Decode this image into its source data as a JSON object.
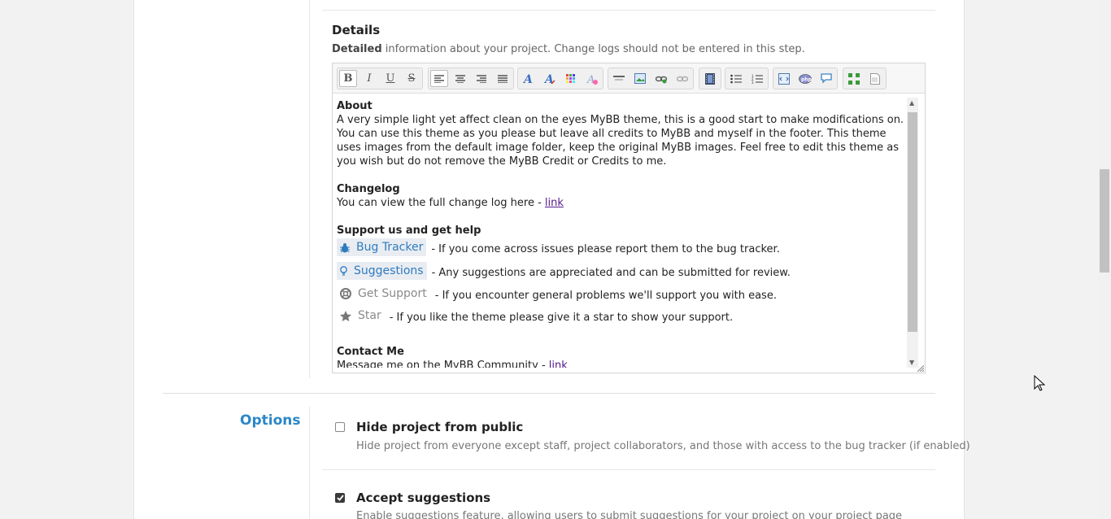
{
  "details": {
    "title": "Details",
    "desc_bold": "Detailed",
    "desc_rest": " information about your project. Change logs should not be entered in this step."
  },
  "toolbar": {
    "bold": "B",
    "italic": "I",
    "underline": "U",
    "strike": "S"
  },
  "content": {
    "about_heading": "About",
    "about_text": "A very simple light yet affect clean on the eyes MyBB theme, this is a good start to make modifications on. You can use this theme as you please but leave all credits to MyBB and myself in the footer. This theme uses images from the default image folder, keep the original MyBB images. Feel free to edit this theme as you wish but do not remove the MyBB Credit or Credits to me.",
    "changelog_heading": "Changelog",
    "changelog_text": "You can view the full change log here - ",
    "changelog_link": "link",
    "support_heading": "Support us and get help",
    "support": [
      {
        "label": "Bug Tracker",
        "text": "- If you come across issues please report them to the bug tracker."
      },
      {
        "label": "Suggestions",
        "text": "- Any suggestions are appreciated and can be submitted for review."
      },
      {
        "label": "Get Support",
        "text": "- If you encounter general problems we'll support you with ease."
      },
      {
        "label": "Star",
        "text": "- If you like the theme please give it a star to show your support."
      }
    ],
    "contact_heading": "Contact Me",
    "contact_text": "Message me on the MyBB Community - ",
    "contact_link": "link"
  },
  "options": {
    "label": "Options",
    "items": [
      {
        "title": "Hide project from public",
        "desc": "Hide project from everyone except staff, project collaborators, and those with access to the bug tracker (if enabled)",
        "checked": false
      },
      {
        "title": "Accept suggestions",
        "desc": "Enable suggestions feature, allowing users to submit suggestions for your project on your project page",
        "checked": true
      }
    ]
  },
  "colors": {
    "accent": "#2b87c7",
    "link": "#551a8b",
    "pill_blue": "#2f7bbf"
  }
}
